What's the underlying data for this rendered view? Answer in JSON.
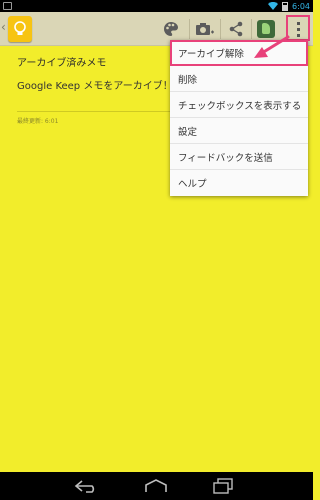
{
  "status_bar": {
    "time": "6:04",
    "icons": [
      "image-icon",
      "wifi-icon",
      "battery-icon"
    ],
    "clock_color": "#33b5e5"
  },
  "action_bar": {
    "app_icon": "keep-lightbulb-icon",
    "actions": [
      "palette-icon",
      "camera-icon",
      "share-icon",
      "evernote-icon",
      "overflow-menu-icon"
    ],
    "callout_color": "#e8417a"
  },
  "note": {
    "title": "アーカイブ済みメモ",
    "body": "Google Keep メモをアーカイブ！",
    "meta": "最終更新: 6:01",
    "background": "#f2ed2b"
  },
  "overflow_menu": {
    "items": [
      {
        "label": "アーカイブ解除",
        "highlighted": true
      },
      {
        "label": "削除"
      },
      {
        "label": "チェックボックスを表示する"
      },
      {
        "label": "設定"
      },
      {
        "label": "フィードバックを送信"
      },
      {
        "label": "ヘルプ"
      }
    ]
  },
  "nav_bar": {
    "buttons": [
      "back-icon",
      "home-icon",
      "recents-icon"
    ]
  }
}
